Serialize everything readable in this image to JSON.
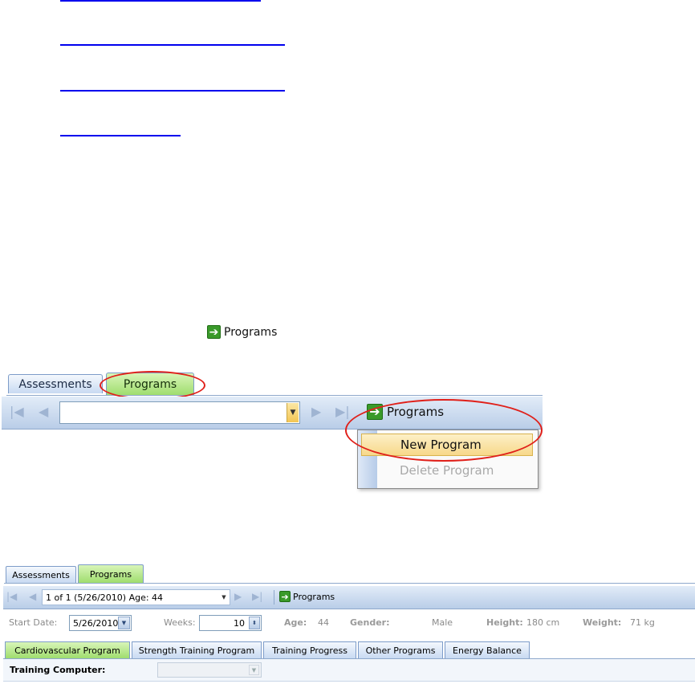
{
  "toolbar_button": {
    "label": "Programs",
    "icon": "green-arrow-icon"
  },
  "zoomed": {
    "tabs": [
      {
        "label": "Assessments"
      },
      {
        "label": "Programs"
      }
    ],
    "combo_value": "",
    "programs_button": "Programs",
    "menu": {
      "new_program": "New Program",
      "delete_program": "Delete Program"
    },
    "highlight_color": "#e0201a"
  },
  "form": {
    "tabs": [
      {
        "label": "Assessments"
      },
      {
        "label": "Programs"
      }
    ],
    "record_selector": "1 of 1 (5/26/2010) Age: 44",
    "programs_button": "Programs",
    "start_date_label": "Start Date:",
    "start_date_value": "5/26/2010",
    "weeks_label": "Weeks:",
    "weeks_value": "10",
    "age_label": "Age:",
    "age_value": "44",
    "gender_label": "Gender:",
    "gender_value": "Male",
    "height_label": "Height:",
    "height_value": "180 cm",
    "weight_label": "Weight:",
    "weight_value": "71 kg",
    "subtabs": [
      {
        "label": "Cardiovascular Program"
      },
      {
        "label": "Strength Training Program"
      },
      {
        "label": "Training Progress"
      },
      {
        "label": "Other Programs"
      },
      {
        "label": "Energy Balance"
      }
    ],
    "training_computer_label": "Training Computer:",
    "training_computer_value": ""
  },
  "colors": {
    "tab_active": "#9fdd6e",
    "toolbar": "#b9cde8",
    "link": "#0000ee"
  }
}
